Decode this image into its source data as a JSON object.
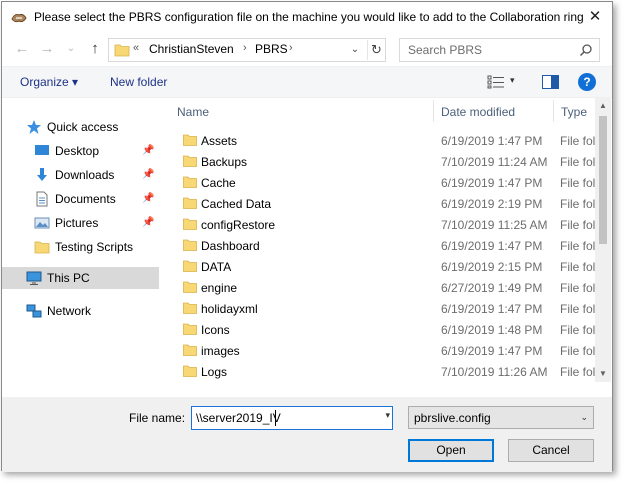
{
  "window": {
    "title": "Please select the PBRS configuration file on the machine you would like to add to the Collaboration ring",
    "close_glyph": "✕"
  },
  "navigation": {
    "back_glyph": "←",
    "forward_glyph": "→",
    "recent_glyph": "⌄",
    "up_glyph": "↑"
  },
  "address": {
    "overflow": "«",
    "segments": [
      "ChristianSteven",
      "PBRS"
    ],
    "separator": "›",
    "dropdown_glyph": "⌄",
    "refresh_glyph": "↻"
  },
  "search": {
    "placeholder": "Search PBRS"
  },
  "toolbar": {
    "organize_label": "Organize ▾",
    "new_folder_label": "New folder",
    "views_dropdown_glyph": "▾",
    "help_label": "?"
  },
  "navpane": {
    "items": [
      {
        "label": "Quick access",
        "icon": "star-icon",
        "pinned": false
      },
      {
        "label": "Desktop",
        "icon": "desktop-icon",
        "pinned": true
      },
      {
        "label": "Downloads",
        "icon": "download-icon",
        "pinned": true
      },
      {
        "label": "Documents",
        "icon": "document-icon",
        "pinned": true
      },
      {
        "label": "Pictures",
        "icon": "pictures-icon",
        "pinned": true
      },
      {
        "label": "Testing Scripts",
        "icon": "folder-icon",
        "pinned": false
      },
      {
        "label": "This PC",
        "icon": "computer-icon",
        "pinned": false,
        "selected": true
      },
      {
        "label": "Network",
        "icon": "network-icon",
        "pinned": false
      }
    ],
    "pin_glyph": "📌"
  },
  "columns": {
    "name": "Name",
    "date": "Date modified",
    "type": "Type"
  },
  "files": [
    {
      "name": "Assets",
      "date": "6/19/2019 1:47 PM",
      "type": "File folder"
    },
    {
      "name": "Backups",
      "date": "7/10/2019 11:24 AM",
      "type": "File folder"
    },
    {
      "name": "Cache",
      "date": "6/19/2019 1:47 PM",
      "type": "File folder"
    },
    {
      "name": "Cached Data",
      "date": "6/19/2019 2:19 PM",
      "type": "File folder"
    },
    {
      "name": "configRestore",
      "date": "7/10/2019 11:25 AM",
      "type": "File folder"
    },
    {
      "name": "Dashboard",
      "date": "6/19/2019 1:47 PM",
      "type": "File folder"
    },
    {
      "name": "DATA",
      "date": "6/19/2019 2:15 PM",
      "type": "File folder"
    },
    {
      "name": "engine",
      "date": "6/27/2019 1:49 PM",
      "type": "File folder"
    },
    {
      "name": "holidayxml",
      "date": "6/19/2019 1:47 PM",
      "type": "File folder"
    },
    {
      "name": "Icons",
      "date": "6/19/2019 1:48 PM",
      "type": "File folder"
    },
    {
      "name": "images",
      "date": "6/19/2019 1:47 PM",
      "type": "File folder"
    },
    {
      "name": "Logs",
      "date": "7/10/2019 11:26 AM",
      "type": "File folder"
    }
  ],
  "scrollbar": {
    "up_glyph": "▲",
    "down_glyph": "▼"
  },
  "bottom": {
    "filename_label": "File name:",
    "filename_value": "\\\\server2019_IV",
    "filename_dropdown_glyph": "▾",
    "filter_value": "pbrslive.config",
    "filter_dropdown_glyph": "⌄",
    "open_label": "Open",
    "cancel_label": "Cancel"
  },
  "colors": {
    "accent": "#0078d7",
    "link": "#1e3287",
    "folder": "#f8d775",
    "selected_bg": "#d9d9d9"
  }
}
